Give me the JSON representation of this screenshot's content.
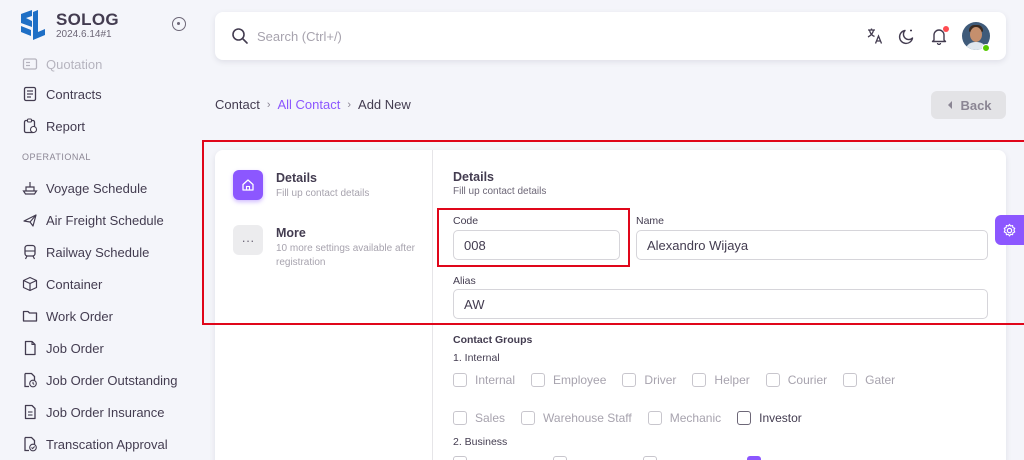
{
  "app": {
    "name": "SOLOG",
    "version": "2024.6.14#1"
  },
  "sidebar": {
    "items_top": [
      {
        "label": "Quotation",
        "icon": "quotation-icon"
      },
      {
        "label": "Contracts",
        "icon": "contracts-icon"
      },
      {
        "label": "Report",
        "icon": "report-icon"
      }
    ],
    "section_label": "OPERATIONAL",
    "items": [
      {
        "label": "Voyage Schedule",
        "icon": "ship-icon"
      },
      {
        "label": "Air Freight Schedule",
        "icon": "plane-icon"
      },
      {
        "label": "Railway Schedule",
        "icon": "train-icon"
      },
      {
        "label": "Container",
        "icon": "box-icon"
      },
      {
        "label": "Work Order",
        "icon": "folder-icon"
      },
      {
        "label": "Job Order",
        "icon": "file-icon"
      },
      {
        "label": "Job Order Outstanding",
        "icon": "file-clock-icon"
      },
      {
        "label": "Job Order Insurance",
        "icon": "file-list-icon"
      },
      {
        "label": "Transcation Approval",
        "icon": "file-check-icon"
      }
    ]
  },
  "topbar": {
    "search_placeholder": "Search (Ctrl+/)"
  },
  "breadcrumb": {
    "root": "Contact",
    "link": "All Contact",
    "current": "Add New"
  },
  "back_label": "Back",
  "steps": [
    {
      "title": "Details",
      "subtitle": "Fill up contact details"
    },
    {
      "title": "More",
      "subtitle": "10 more settings available after registration"
    }
  ],
  "form": {
    "title": "Details",
    "subtitle": "Fill up contact details",
    "code": {
      "label": "Code",
      "value": "008"
    },
    "name": {
      "label": "Name",
      "value": "Alexandro Wijaya"
    },
    "alias": {
      "label": "Alias",
      "value": "AW"
    },
    "groups_title": "Contact Groups",
    "group_internal": "1. Internal",
    "internal_row1": [
      "Internal",
      "Employee",
      "Driver",
      "Helper",
      "Courier",
      "Gater"
    ],
    "internal_row2": [
      "Sales",
      "Warehouse Staff",
      "Mechanic",
      "Investor"
    ],
    "group_business": "2. Business"
  },
  "colors": {
    "primary": "#8c57ff",
    "highlight": "#e0061a"
  }
}
